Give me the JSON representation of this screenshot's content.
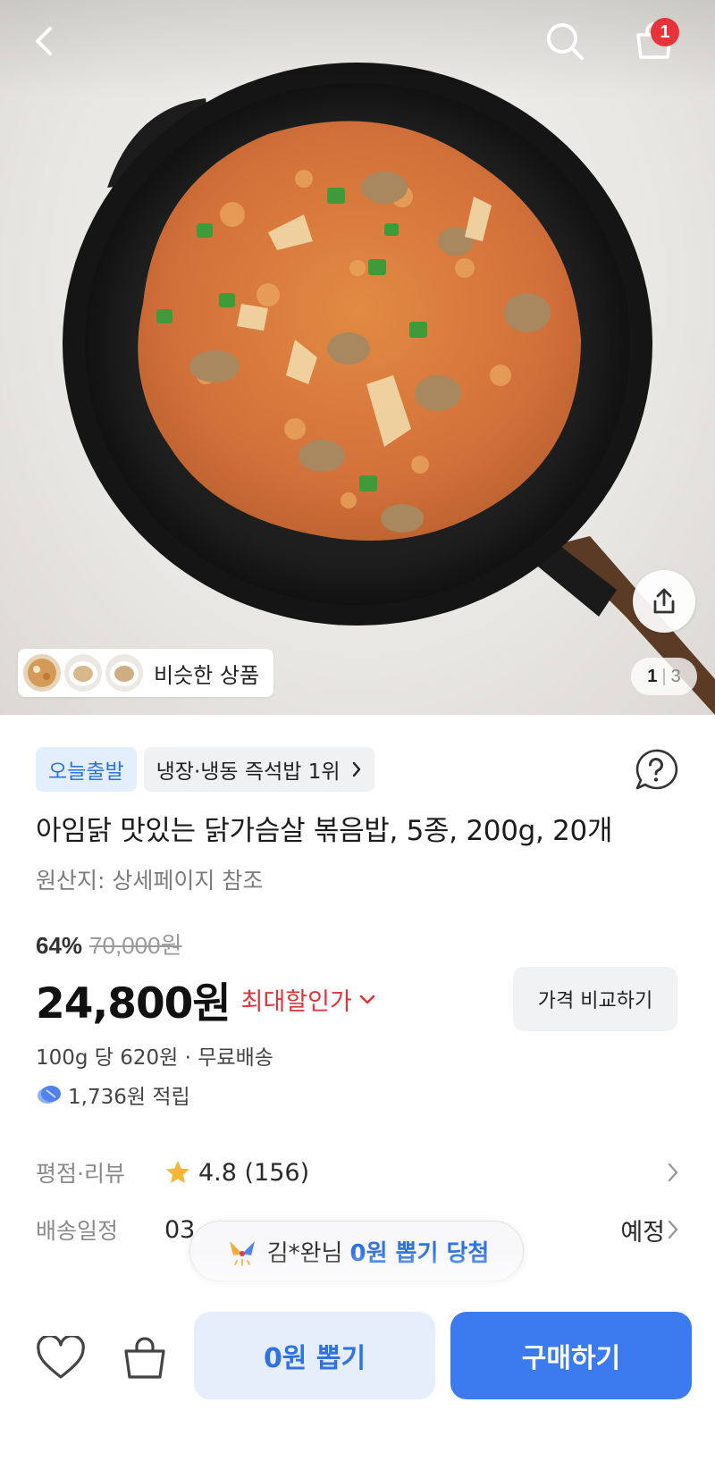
{
  "header": {
    "back_icon": "chevron-left-icon",
    "search_icon": "search-icon",
    "cart_icon": "shopping-bag-icon",
    "cart_count": "1"
  },
  "gallery": {
    "current": "1",
    "total": "3",
    "similar_label": "비슷한 상품",
    "share_icon": "share-icon"
  },
  "product": {
    "tags": {
      "today_departure": "오늘출발",
      "ranking": "냉장·냉동 즉석밥 1위"
    },
    "title": "아임닭 맛있는 닭가슴살 볶음밥, 5종, 200g, 20개",
    "origin": "원산지: 상세페이지 참조",
    "discount_rate": "64%",
    "original_price": "70,000원",
    "price": "24,800원",
    "max_discount_label": "최대할인가",
    "compare_label": "가격 비교하기",
    "unit_price": "100g 당 620원 · 무료배송",
    "points": "1,736원 적립"
  },
  "info": {
    "rating_label": "평점·리뷰",
    "rating_value": "4.8 (156)",
    "delivery_label": "배송일정",
    "delivery_value_start": "03",
    "delivery_value_end": "예정"
  },
  "toast": {
    "user": "김*완님",
    "highlight": "0원 뽑기 당첨"
  },
  "bottom_bar": {
    "zero_draw_label": "0원 뽑기",
    "buy_label": "구매하기"
  },
  "colors": {
    "accent_blue": "#3b7bef",
    "discount_red": "#e0343c",
    "badge_red": "#e8323c"
  }
}
